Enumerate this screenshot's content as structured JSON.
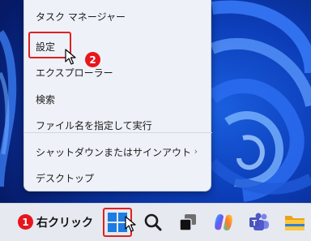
{
  "menu": {
    "items": [
      {
        "label": "タスク マネージャー"
      },
      {
        "label": "設定"
      },
      {
        "label": "エクスプローラー"
      },
      {
        "label": "検索"
      },
      {
        "label": "ファイル名を指定して実行"
      },
      {
        "label": "シャットダウンまたはサインアウト",
        "submenu_indicator": "›"
      },
      {
        "label": "デスクトップ"
      }
    ]
  },
  "annotations": {
    "step1": {
      "number": "1",
      "text": "右クリック"
    },
    "step2": {
      "number": "2"
    }
  },
  "taskbar": {
    "icons": [
      "windows-start-icon",
      "search-icon",
      "task-view-icon",
      "copilot-icon",
      "teams-icon",
      "file-explorer-icon"
    ]
  },
  "colors": {
    "annotation_red": "#e02020",
    "badge_red": "#e8151b",
    "menu_bg": "#eef1f7",
    "taskbar_bg": "#e6e9f0",
    "windows_blue": "#1e7be0"
  }
}
